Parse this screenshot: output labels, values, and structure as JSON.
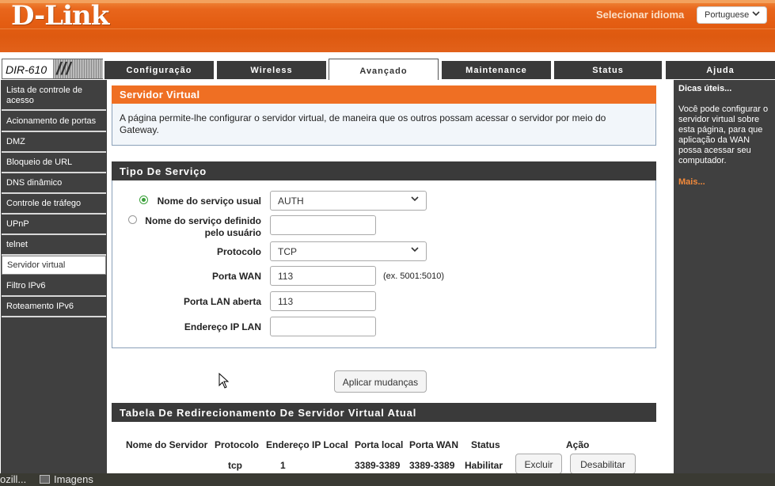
{
  "header": {
    "logo": "D-Link",
    "logo_mark": "®",
    "lang_label": "Selecionar idioma",
    "lang_value": "Portuguese"
  },
  "model": {
    "name": "DIR-610"
  },
  "tabs": [
    {
      "label": "Configuração",
      "active": false
    },
    {
      "label": "Wireless",
      "active": false
    },
    {
      "label": "Avançado",
      "active": true
    },
    {
      "label": "Maintenance",
      "active": false
    },
    {
      "label": "Status",
      "active": false
    },
    {
      "label": "Ajuda",
      "active": false
    }
  ],
  "sidebar": {
    "items": [
      {
        "label": "Lista de controle de acesso"
      },
      {
        "label": "Acionamento de portas"
      },
      {
        "label": "DMZ"
      },
      {
        "label": "Bloqueio de URL"
      },
      {
        "label": "DNS dinâmico"
      },
      {
        "label": "Controle de tráfego"
      },
      {
        "label": "UPnP"
      },
      {
        "label": "telnet"
      },
      {
        "label": "Servidor virtual",
        "active": true
      },
      {
        "label": "Filtro IPv6"
      },
      {
        "label": "Roteamento IPv6"
      }
    ]
  },
  "main": {
    "section_title": "Servidor Virtual",
    "description": "A página permite-lhe configurar o servidor virtual, de maneira que os outros possam acessar o servidor por meio do Gateway.",
    "service": {
      "title": "Tipo De Serviço",
      "usual_label": "Nome do serviço usual",
      "usual_value": "AUTH",
      "usual_selected": true,
      "custom_label_1": "Nome do serviço definido",
      "custom_label_2": "pelo usuário",
      "custom_value": "",
      "protocol_label": "Protocolo",
      "protocol_value": "TCP",
      "wan_label": "Porta WAN",
      "wan_value": "113",
      "wan_hint": "(ex. 5001:5010)",
      "lan_label": "Porta LAN aberta",
      "lan_value": "113",
      "ip_label": "Endereço IP LAN",
      "ip_value": ""
    },
    "apply_label": "Aplicar mudanças",
    "table": {
      "title": "Tabela De Redirecionamento De Servidor Virtual Atual",
      "headers": [
        "Nome do Servidor",
        "Protocolo",
        "Endereço IP Local",
        "Porta local",
        "Porta WAN",
        "Status",
        "Ação"
      ],
      "rows": [
        {
          "name": "",
          "protocol": "tcp",
          "ip": "1",
          "local_port": "3389-3389",
          "wan_port": "3389-3389",
          "status": "Habilitar",
          "btn_delete": "Excluir",
          "btn_disable": "Desabilitar"
        }
      ]
    }
  },
  "help": {
    "title": "Dicas úteis...",
    "text": "Você pode configurar o servidor virtual sobre esta página, para que aplicação da WAN possa acessar seu computador.",
    "more": "Mais..."
  },
  "taskbar": {
    "item1": "ozill...",
    "item2": "Imagens"
  },
  "colors": {
    "brand_orange": "#ef6f23",
    "dark_panel": "#3a3a3a",
    "radio_green": "#3aa03a",
    "help_link": "#f48a3a"
  }
}
